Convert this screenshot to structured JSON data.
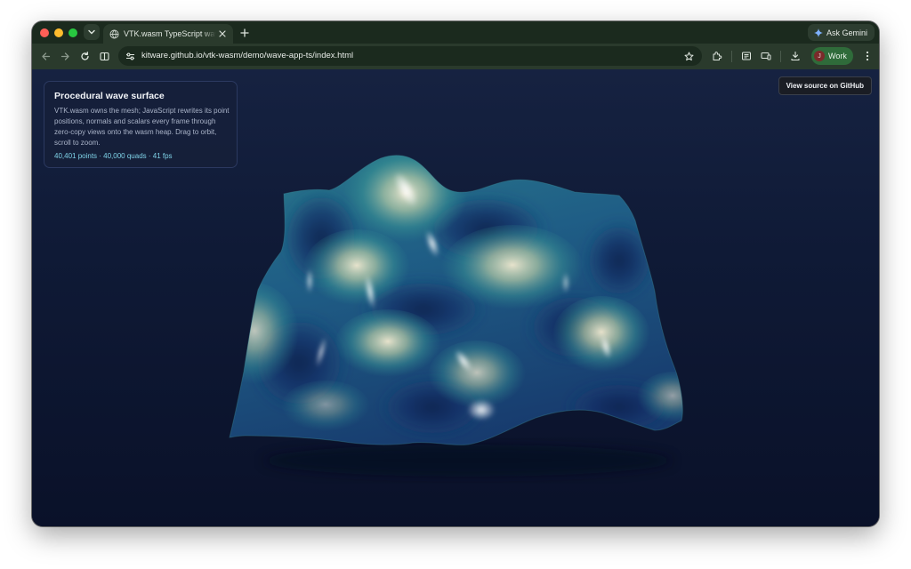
{
  "browser": {
    "tab": {
      "title": "VTK.wasm TypeScript wave demo",
      "close_icon": "close-icon",
      "favicon": "globe-icon"
    },
    "new_tab_icon": "plus-icon",
    "ask_gemini_label": "Ask Gemini",
    "url": "kitware.github.io/vtk-wasm/demo/wave-app-ts/index.html",
    "profile": {
      "initial": "J",
      "label": "Work"
    },
    "icons": [
      "back-icon",
      "forward-icon",
      "reload-icon",
      "split-view-icon",
      "site-settings-icon",
      "star-icon",
      "extensions-icon",
      "reading-list-icon",
      "cast-icon",
      "download-icon",
      "kebab-menu-icon"
    ]
  },
  "page": {
    "panel": {
      "title": "Procedural wave surface",
      "description": "VTK.wasm owns the mesh; JavaScript rewrites its point positions, normals and scalars every frame through zero-copy views onto the wasm heap. Drag to orbit, scroll to zoom.",
      "stats": "40,401 points · 40,000 quads · 41 fps"
    },
    "github_button_label": "View source on GitHub"
  },
  "colors": {
    "background_top": "#162241",
    "background_bottom": "#0a1129",
    "surface_low": "#1d3a6e",
    "surface_mid": "#2e8a8e",
    "surface_high": "#e9e0b8",
    "stats_accent": "#7fd3e8",
    "profile_chip": "#2f6b3a"
  }
}
